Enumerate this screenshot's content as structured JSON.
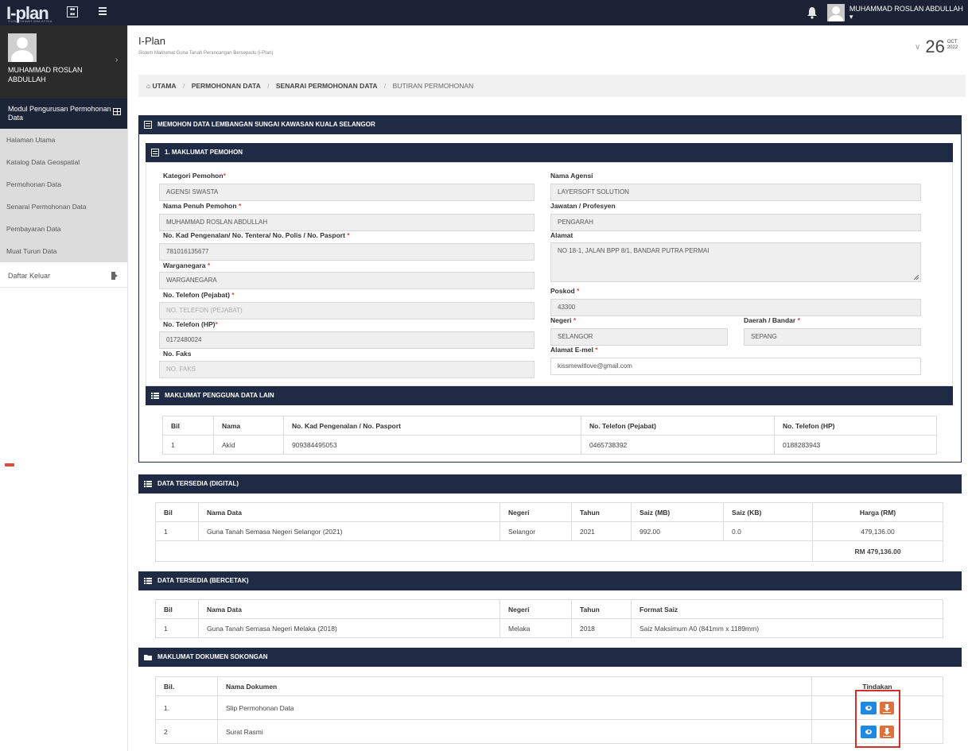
{
  "topbar": {
    "logo_text": "I-plan",
    "logo_sub": "GUNA TANAH MALAYSIA",
    "user_name": "MUHAMMAD ROSLAN ABDULLAH ▾"
  },
  "sidebar": {
    "user_name": "MUHAMMAD ROSLAN ABDULLAH",
    "module": "Modul Pengurusan Permohonan Data",
    "items": [
      {
        "label": "Halaman Utama"
      },
      {
        "label": "Katalog Data Geospatial"
      },
      {
        "label": "Permohonan Data"
      },
      {
        "label": "Senarai Permohonan Data"
      },
      {
        "label": "Pembayaran Data"
      },
      {
        "label": "Muat Turun Data"
      }
    ],
    "logout": "Daftar Keluar"
  },
  "header": {
    "title": "I-Plan",
    "subtitle": "Sistem Maklumat Guna Tanah Perancangan Bersepadu (i-Plan)",
    "date_day": "26",
    "date_month": "OCT",
    "date_year": "2022"
  },
  "breadcrumb": {
    "home": "UTAMA",
    "b1": "PERMOHONAN DATA",
    "b2": "SENARAI PERMOHONAN DATA",
    "b3": "BUTIRAN PERMOHONAN"
  },
  "panel_main": {
    "title": "MEMOHON DATA LEMBANGAN SUNGAI KAWASAN KUALA SELANGOR"
  },
  "applicant": {
    "title": "1. MAKLUMAT PEMOHON",
    "kategori_label": "Kategori Pemohon",
    "kategori": "AGENSI SWASTA",
    "nama_label": "Nama Penuh Pemohon ",
    "nama": "MUHAMMAD ROSLAN ABDULLAH",
    "ic_label": "No. Kad Pengenalan/ No. Tentera/ No. Polis / No. Pasport ",
    "ic": "781016135677",
    "warga_label": "Warganegara ",
    "warga": "WARGANEGARA",
    "tel_off_label": "No. Telefon (Pejabat) ",
    "tel_off_ph": "NO. TELEFON (PEJABAT)",
    "tel_hp_label": "No. Telefon (HP)",
    "tel_hp": "0172480024",
    "faks_label": "No. Faks",
    "faks_ph": "NO. FAKS",
    "agensi_label": "Nama Agensi",
    "agensi": "LAYERSOFT SOLUTION",
    "jawatan_label": "Jawatan / Profesyen",
    "jawatan": "PENGARAH",
    "alamat_label": "Alamat",
    "alamat": "NO 18-1, JALAN BPP 8/1, BANDAR PUTRA PERMAI",
    "poskod_label": "Poskod ",
    "poskod": "43300",
    "negeri_label": "Negeri ",
    "negeri": "SELANGOR",
    "daerah_label": "Daerah / Bandar ",
    "daerah": "SEPANG",
    "email_label": "Alamat E-mel ",
    "email": "kissmewitlove@gmail.com",
    "req": "*"
  },
  "other_users": {
    "title": "MAKLUMAT PENGGUNA DATA LAIN",
    "headers": [
      "Bil",
      "Nama",
      "No. Kad Pengenalan / No. Pasport",
      "No. Telefon (Pejabat)",
      "No. Telefon (HP)"
    ],
    "rows": [
      [
        "1",
        "Akid",
        "909384495053",
        "0465738392",
        "0188283943"
      ]
    ]
  },
  "digital": {
    "title": "DATA TERSEDIA (DIGITAL)",
    "headers": [
      "Bil",
      "Nama Data",
      "Negeri",
      "Tahun",
      "Saiz (MB)",
      "Saiz (KB)",
      "Harga (RM)"
    ],
    "rows": [
      [
        "1",
        "Guna Tanah Semasa Negeri Selangor (2021)",
        "Selangor",
        "2021",
        "992.00",
        "0.0",
        "479,136.00"
      ]
    ],
    "total": "RM 479,136.00"
  },
  "printed": {
    "title": "DATA TERSEDIA (BERCETAK)",
    "headers": [
      "Bil",
      "Nama Data",
      "Negeri",
      "Tahun",
      "Format Saiz"
    ],
    "rows": [
      [
        "1",
        "Guna Tanah Semasa Negeri Melaka (2018)",
        "Melaka",
        "2018",
        "Saiz Maksimum A0 (841mm x 1189mm)"
      ]
    ]
  },
  "documents": {
    "title": "MAKLUMAT DOKUMEN SOKONGAN",
    "headers": [
      "Bil.",
      "Nama Dokumen",
      "Tindakan"
    ],
    "rows": [
      [
        "1.",
        "Slip Permohonan Data"
      ],
      [
        "2",
        "Surat Rasmi"
      ]
    ]
  },
  "colors": {
    "navy": "#1f2a44",
    "blue": "#1e88e5",
    "orange": "#e0713f",
    "red_highlight": "#d32f2f"
  }
}
